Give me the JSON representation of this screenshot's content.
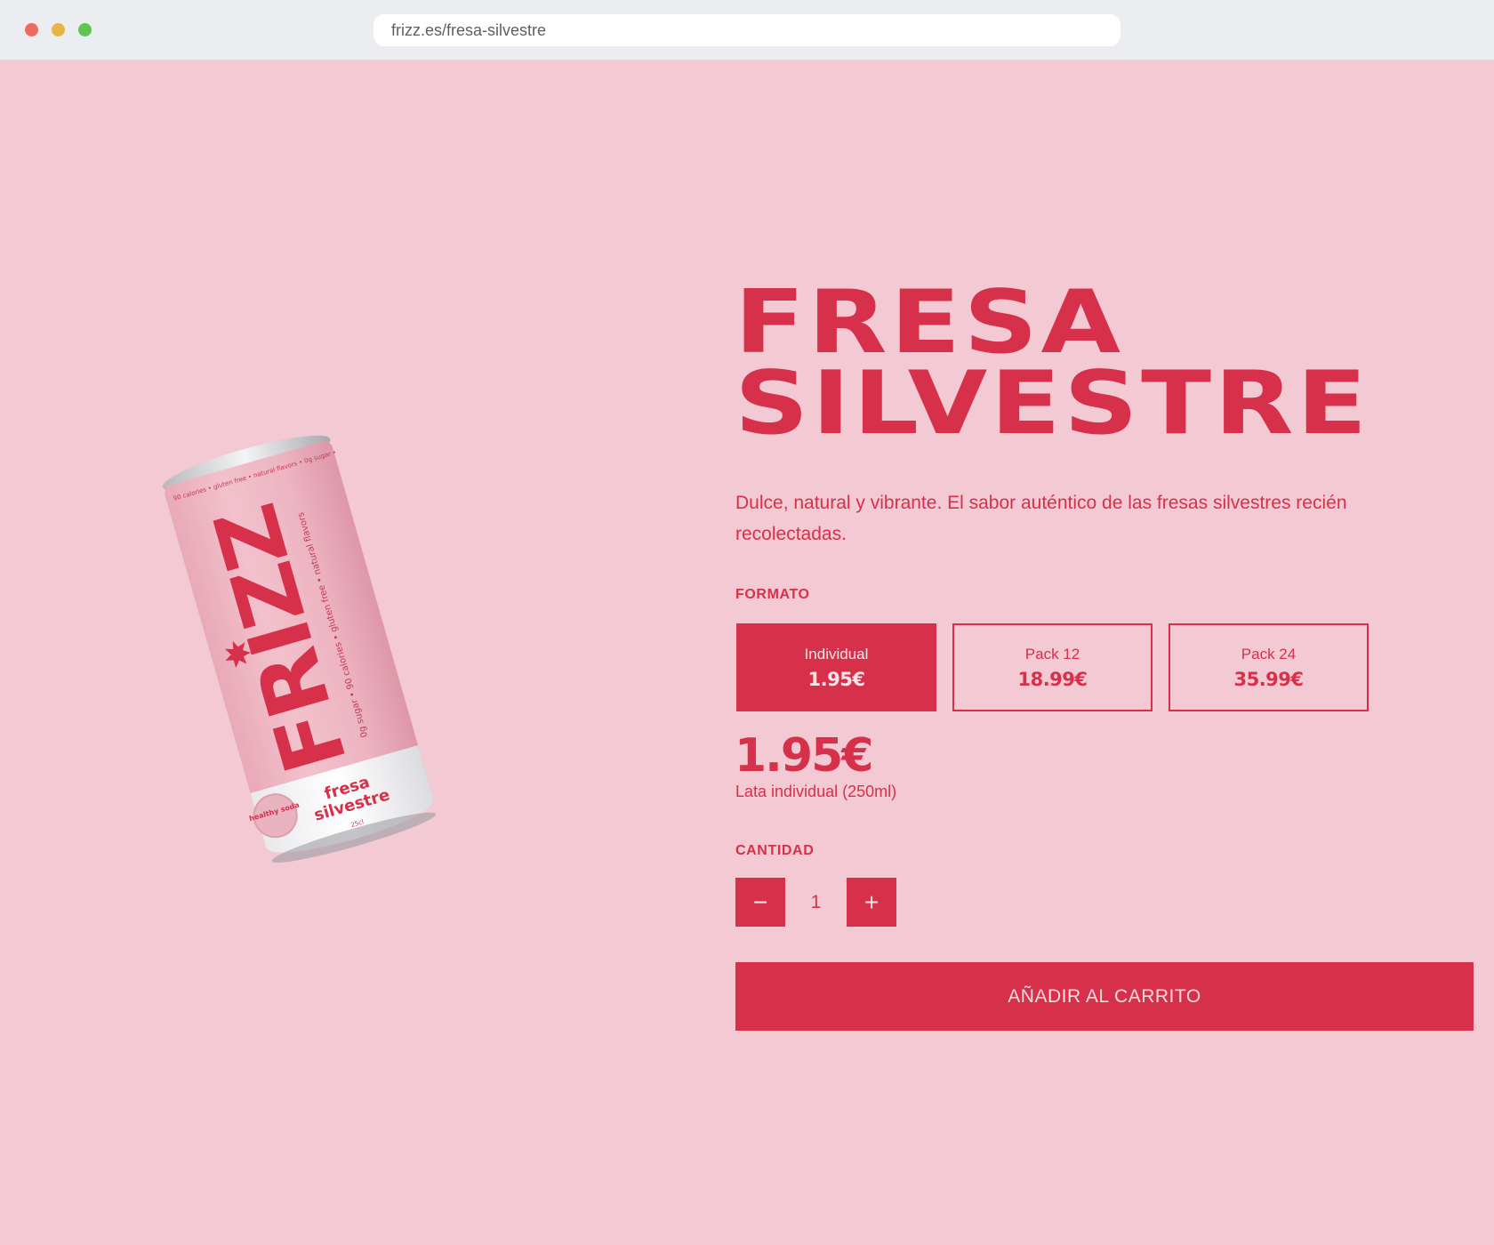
{
  "browser": {
    "url": "frizz.es/fresa-silvestre"
  },
  "product": {
    "title_line1": "FRESA",
    "title_line2": "SILVESTRE",
    "description": "Dulce, natural y vibrante. El sabor auténtico de las fresas silvestres recién recolectadas.",
    "price": "1.95€",
    "price_note": "Lata individual (250ml)"
  },
  "can": {
    "brand": "FRIZZ",
    "flavor_line1": "fresa",
    "flavor_line2": "silvestre",
    "volume": "25cl",
    "badge": "healthy soda",
    "side_text": "0g sugar • 90 calories • gluten free • natural flavors",
    "top_text": "90 calories • gluten free • natural flavors • 0g sugar •"
  },
  "format": {
    "label": "FORMATO",
    "options": [
      {
        "name": "Individual",
        "price": "1.95€",
        "selected": true
      },
      {
        "name": "Pack 12",
        "price": "18.99€",
        "selected": false
      },
      {
        "name": "Pack 24",
        "price": "35.99€",
        "selected": false
      }
    ]
  },
  "quantity": {
    "label": "CANTIDAD",
    "value": "1",
    "minus": "−",
    "plus": "+"
  },
  "cta": {
    "add_to_cart": "AÑADIR AL CARRITO"
  },
  "colors": {
    "background": "#f3c9d3",
    "accent": "#d7304a",
    "can_body": "#eeb6c3"
  }
}
